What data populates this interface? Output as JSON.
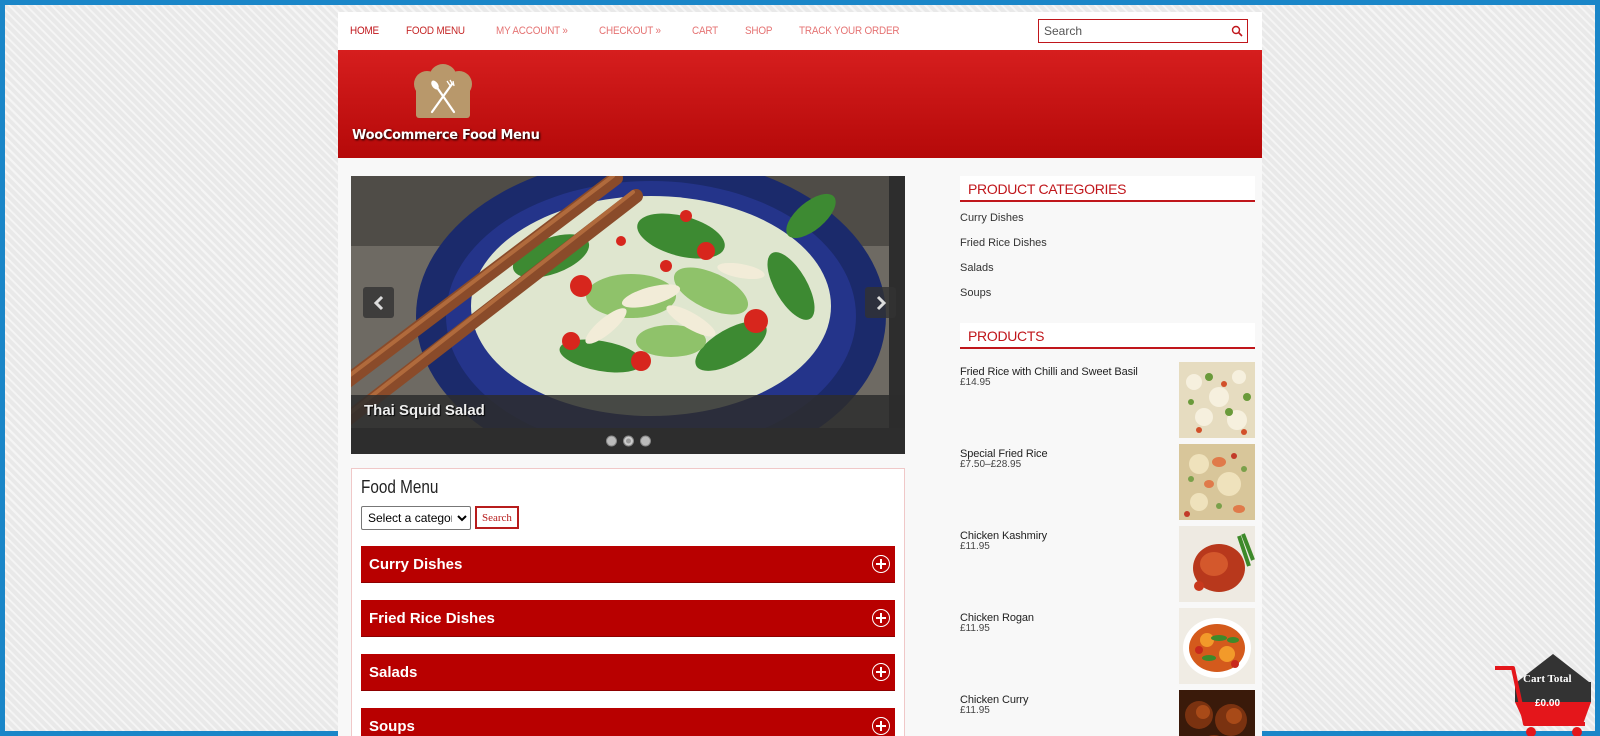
{
  "nav": {
    "items": [
      {
        "label": "HOME",
        "state": "active"
      },
      {
        "label": "FOOD MENU",
        "state": "plain"
      },
      {
        "label": "MY ACCOUNT »",
        "state": "muted"
      },
      {
        "label": "CHECKOUT »",
        "state": "muted"
      },
      {
        "label": "CART",
        "state": "muted"
      },
      {
        "label": "SHOP",
        "state": "muted"
      },
      {
        "label": "TRACK YOUR ORDER",
        "state": "muted"
      }
    ],
    "search_placeholder": "Search"
  },
  "header": {
    "site_title": "WooCommerce Food Menu"
  },
  "slider": {
    "caption": "Thai Squid Salad",
    "slide_count": 3,
    "active_slide": 2
  },
  "food_menu": {
    "title": "Food Menu",
    "select_value": "Select a category",
    "search_button": "Search",
    "categories": [
      "Curry Dishes",
      "Fried Rice Dishes",
      "Salads",
      "Soups"
    ]
  },
  "sidebar": {
    "categories_title": "PRODUCT CATEGORIES",
    "categories": [
      "Curry Dishes",
      "Fried Rice Dishes",
      "Salads",
      "Soups"
    ],
    "products_title": "PRODUCTS",
    "products": [
      {
        "name": "Fried Rice with Chilli and Sweet Basil",
        "price": "£14.95"
      },
      {
        "name": "Special Fried Rice",
        "price": "£7.50–£28.95"
      },
      {
        "name": "Chicken Kashmiry",
        "price": "£11.95"
      },
      {
        "name": "Chicken Rogan",
        "price": "£11.95"
      },
      {
        "name": "Chicken Curry",
        "price": "£11.95"
      }
    ]
  },
  "cart": {
    "label": "Cart Total",
    "value": "£0.00"
  },
  "colors": {
    "brand_red": "#c0161b",
    "frame_blue": "#1a86c8"
  }
}
